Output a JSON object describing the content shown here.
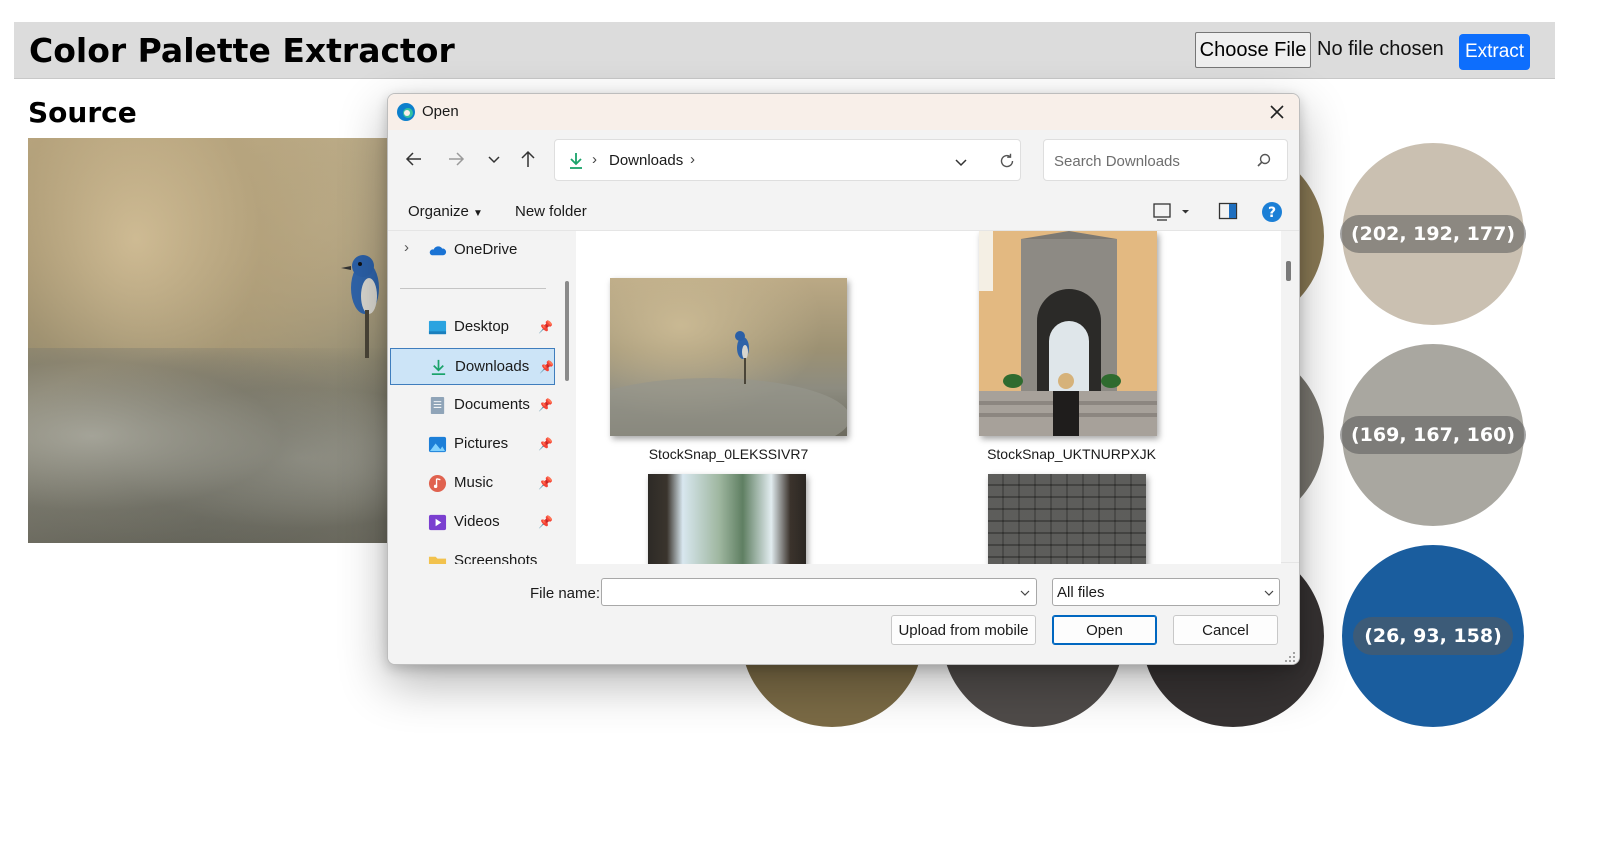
{
  "page": {
    "title": "Color Palette Extractor",
    "choose_file_label": "Choose File",
    "file_status": "No file chosen",
    "extract_label": "Extract",
    "source_heading": "Source"
  },
  "palette": {
    "swatches": [
      {
        "label": "(202, 192, 177)",
        "color": "#cac0b1"
      },
      {
        "label": "(169, 167, 160)",
        "color": "#a9a7a0"
      },
      {
        "label": "(26, 93, 158)",
        "color": "#1a5d9e"
      }
    ],
    "partial_colors": [
      "#8a7a55",
      "#7a7770",
      "#7a6a45",
      "#4f4b49",
      "#363232"
    ]
  },
  "dialog": {
    "title": "Open",
    "app_icon": "edge-icon",
    "address": {
      "folder": "Downloads"
    },
    "search_placeholder": "Search Downloads",
    "toolbar": {
      "organize": "Organize",
      "new_folder": "New folder"
    },
    "nav": {
      "onedrive": "OneDrive",
      "items": [
        {
          "label": "Desktop",
          "icon": "desktop-icon"
        },
        {
          "label": "Downloads",
          "icon": "download-icon",
          "selected": true
        },
        {
          "label": "Documents",
          "icon": "documents-icon"
        },
        {
          "label": "Pictures",
          "icon": "pictures-icon"
        },
        {
          "label": "Music",
          "icon": "music-icon"
        },
        {
          "label": "Videos",
          "icon": "videos-icon"
        },
        {
          "label": "Screenshots",
          "icon": "folder-icon"
        }
      ]
    },
    "files": [
      {
        "name": "StockSnap_0LEKSSIVR7"
      },
      {
        "name": "StockSnap_UKTNURPXJK"
      },
      {
        "name": ""
      },
      {
        "name": ""
      }
    ],
    "footer": {
      "file_name_label": "File name:",
      "file_name_value": "",
      "file_type": "All files",
      "upload_mobile": "Upload from mobile",
      "open": "Open",
      "cancel": "Cancel"
    }
  }
}
